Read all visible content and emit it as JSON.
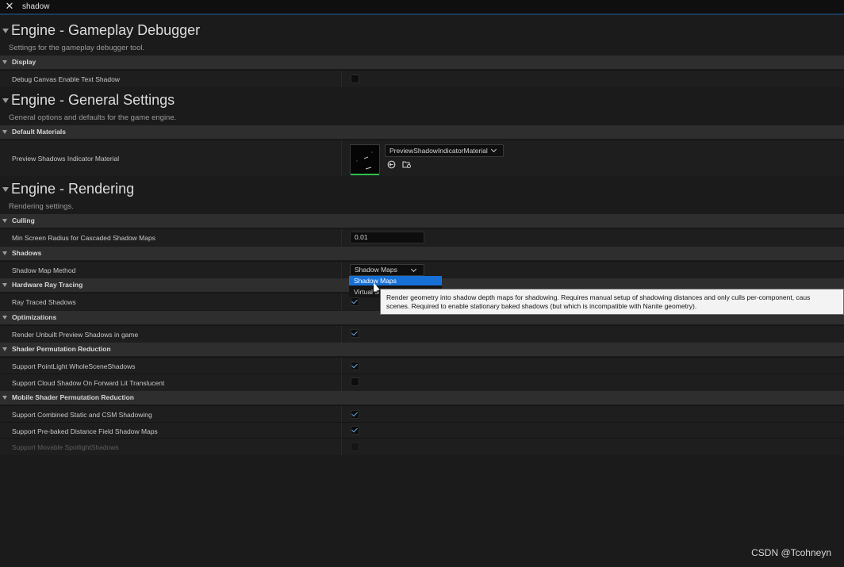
{
  "search": {
    "query": "shadow",
    "close_icon": "close-icon"
  },
  "sections": {
    "gameplay_debugger": {
      "title": "Engine - Gameplay Debugger",
      "description": "Settings for the gameplay debugger tool.",
      "display": {
        "label": "Display",
        "debug_canvas_text_shadow": {
          "label": "Debug Canvas Enable Text Shadow",
          "checked": false
        }
      }
    },
    "general_settings": {
      "title": "Engine - General Settings",
      "description": "General options and defaults for the game engine.",
      "default_materials": {
        "label": "Default Materials",
        "preview_shadows_material": {
          "label": "Preview Shadows Indicator Material",
          "value": "PreviewShadowIndicatorMaterial"
        }
      }
    },
    "rendering": {
      "title": "Engine - Rendering",
      "description": "Rendering settings.",
      "culling": {
        "label": "Culling",
        "min_screen_radius": {
          "label": "Min Screen Radius for Cascaded Shadow Maps",
          "value": "0.01"
        }
      },
      "shadows": {
        "label": "Shadows",
        "shadow_map_method": {
          "label": "Shadow Map Method",
          "value": "Shadow Maps",
          "options": [
            "Shadow Maps",
            "Virtual S"
          ]
        }
      },
      "hardware_ray_tracing": {
        "label": "Hardware Ray Tracing",
        "ray_traced_shadows": {
          "label": "Ray Traced Shadows",
          "checked": true
        }
      },
      "optimizations": {
        "label": "Optimizations",
        "render_unbuilt_preview": {
          "label": "Render Unbuilt Preview Shadows in game",
          "checked": true
        }
      },
      "shader_permutation": {
        "label": "Shader Permutation Reduction",
        "pointlight": {
          "label": "Support PointLight WholeSceneShadows",
          "checked": true
        },
        "cloud_shadow": {
          "label": "Support Cloud Shadow On Forward Lit Translucent",
          "checked": false
        }
      },
      "mobile_shader_permutation": {
        "label": "Mobile Shader Permutation Reduction",
        "combined_static_csm": {
          "label": "Support Combined Static and CSM Shadowing",
          "checked": true
        },
        "prebaked_distance_field": {
          "label": "Support Pre-baked Distance Field Shadow Maps",
          "checked": true
        },
        "movable_spotlight": {
          "label": "Support Movable SpotlightShadows",
          "checked": false,
          "disabled": true
        }
      }
    }
  },
  "tooltip": {
    "line1": "Render geometry into shadow depth maps for shadowing.  Requires manual setup of shadowing distances and only culls per-component, caus",
    "line2": "scenes.  Required to enable stationary baked shadows (but which is incompatible with Nanite geometry)."
  },
  "watermark": "CSDN @Tcohneyn",
  "colors": {
    "selection": "#1770d6",
    "checkmark": "#6da3df",
    "thumbnail_underline": "#2ec04b"
  }
}
